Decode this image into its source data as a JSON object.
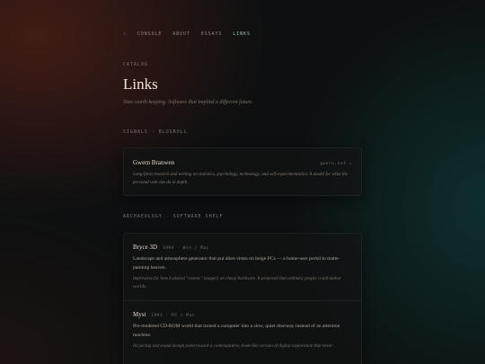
{
  "nav": {
    "home": "›",
    "items": [
      "CONSOLE",
      "ABOUT",
      "ESSAYS",
      "LINKS"
    ]
  },
  "header": {
    "kicker": "CATALOG",
    "title": "Links",
    "subtitle": "Sites worth keeping. Software that implied a different future."
  },
  "blogroll": {
    "kicker": "SIGNALS · BLOGROLL",
    "cards": [
      {
        "name": "Gwern Branwen",
        "meta": "gwern.net ↗",
        "desc": "Long-form research and writing on statistics, psychology, technology, and self-experimentation. A model for what the personal web can do in depth."
      }
    ]
  },
  "shelf": {
    "kicker": "ARCHAEOLOGY · SOFTWARE SHELF",
    "items": [
      {
        "name": "Bryce 3D",
        "meta": "1994 · Win / Mac",
        "body": "Landscape and atmosphere generator that put alien vistas on beige PCs — a home-user portal to matte-painting heaven.",
        "note": "Impressive for how it placed \"cosmic\" imagery on cheap hardware. It proposed that ordinary people could author worlds."
      },
      {
        "name": "Myst",
        "meta": "1993 · PC / Mac",
        "body": "Pre-rendered CD-ROM world that turned a computer into a slow, quiet doorway instead of an attention machine.",
        "note": "Its pacing and sound design point toward a contemplative, book-like version of digital exploration that never"
      }
    ]
  },
  "colors": {
    "accent": "#7fc6bb",
    "warm_glow": "#6e261a",
    "cool_glow": "#0e4846"
  }
}
